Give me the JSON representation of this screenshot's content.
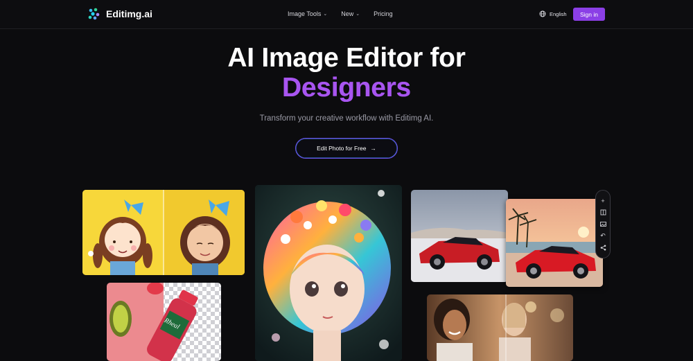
{
  "brand": {
    "name": "Editimg.ai"
  },
  "nav": {
    "items": [
      {
        "label": "Image Tools",
        "has_dropdown": true
      },
      {
        "label": "New",
        "has_dropdown": true
      },
      {
        "label": "Pricing",
        "has_dropdown": false
      }
    ],
    "language": "English",
    "signin_label": "Sign in"
  },
  "hero": {
    "title_line1": "AI Image Editor for",
    "title_line2": "Designers",
    "subtitle": "Transform your creative workflow with Editimg AI.",
    "cta_label": "Edit Photo for Free"
  },
  "gallery": {
    "bottle_label": "Rheal",
    "bottle_sub": "berry\nboost"
  },
  "colors": {
    "background": "#0c0c0e",
    "accent": "#8b3fe6",
    "highlight_text": "#a855f0",
    "cta_border": "#6c4de6"
  }
}
